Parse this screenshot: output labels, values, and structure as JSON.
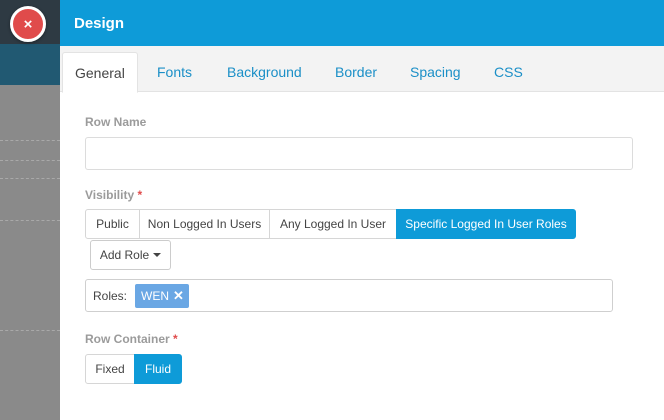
{
  "modal": {
    "title": "Design",
    "close_glyph": "×"
  },
  "tabs": [
    {
      "label": "General",
      "active": true
    },
    {
      "label": "Fonts",
      "active": false
    },
    {
      "label": "Background",
      "active": false
    },
    {
      "label": "Border",
      "active": false
    },
    {
      "label": "Spacing",
      "active": false
    },
    {
      "label": "CSS",
      "active": false
    }
  ],
  "row_name": {
    "label": "Row Name",
    "value": ""
  },
  "visibility": {
    "label": "Visibility",
    "required": "*",
    "options": [
      "Public",
      "Non Logged In Users",
      "Any Logged In User",
      "Specific Logged In User Roles"
    ],
    "selected": "Specific Logged In User Roles",
    "add_role_label": "Add Role",
    "roles_label": "Roles:",
    "roles": [
      {
        "name": "WEN",
        "remove_glyph": "✕"
      }
    ]
  },
  "row_container": {
    "label": "Row Container",
    "required": "*",
    "options": [
      "Fixed",
      "Fluid"
    ],
    "selected": "Fluid"
  },
  "colors": {
    "accent": "#0e9bd8",
    "close": "#e04b4b",
    "tag": "#6aa7e4"
  }
}
